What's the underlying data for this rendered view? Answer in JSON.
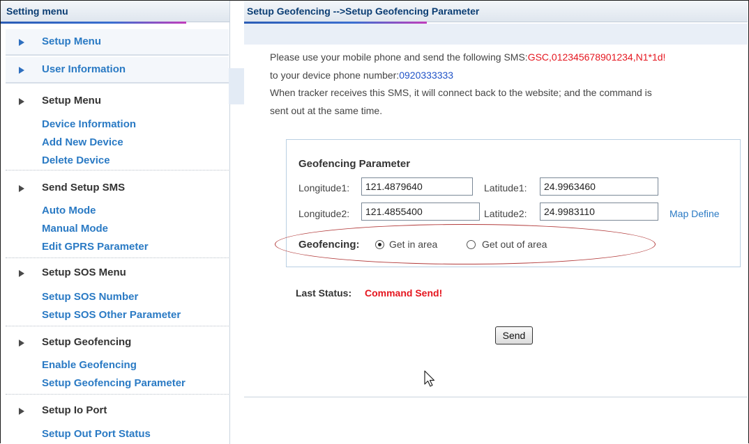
{
  "sidebar": {
    "header": "Setting menu",
    "top_items": [
      "Setup Menu",
      "User Information"
    ],
    "sections": [
      {
        "title": "Setup Menu",
        "links": [
          "Device Information",
          "Add New Device",
          "Delete Device"
        ]
      },
      {
        "title": "Send Setup SMS",
        "links": [
          "Auto Mode",
          "Manual Mode",
          "Edit GPRS Parameter"
        ]
      },
      {
        "title": "Setup SOS Menu",
        "links": [
          "Setup SOS Number",
          "Setup SOS Other Parameter"
        ]
      },
      {
        "title": "Setup Geofencing",
        "links": [
          "Enable Geofencing",
          "Setup Geofencing Parameter"
        ]
      },
      {
        "title": "Setup Io Port",
        "links": [
          "Setup Out Port Status"
        ]
      }
    ]
  },
  "main": {
    "header": "Setup Geofencing -->Setup Geofencing Parameter",
    "instructions": {
      "line1_prefix": "Please use your mobile phone and send the following SMS:",
      "sms_text": "GSC,012345678901234,N1*1d!",
      "line2_prefix": "to your device phone number:",
      "phone": "0920333333",
      "line3": "When tracker receives this SMS, it will connect back to the website; and the command is",
      "line4": "sent out at the same time."
    },
    "params": {
      "title": "Geofencing Parameter",
      "longitude1_label": "Longitude1:",
      "longitude1_value": "121.4879640",
      "latitude1_label": "Latitude1:",
      "latitude1_value": "24.9963460",
      "longitude2_label": "Longitude2:",
      "longitude2_value": "121.4855400",
      "latitude2_label": "Latitude2:",
      "latitude2_value": "24.9983110",
      "map_define": "Map Define",
      "geofencing_label": "Geofencing:",
      "option_in": "Get in area",
      "option_out": "Get out of area",
      "selected": "Get in area"
    },
    "status": {
      "label": "Last Status:",
      "value": "Command Send!"
    },
    "send_label": "Send"
  },
  "colors": {
    "link": "#2a7ac4",
    "header_text": "#0b3d73",
    "sms_red": "#e5161f",
    "phone_blue": "#1f52c7",
    "highlight_ellipse": "#b23a3a"
  }
}
